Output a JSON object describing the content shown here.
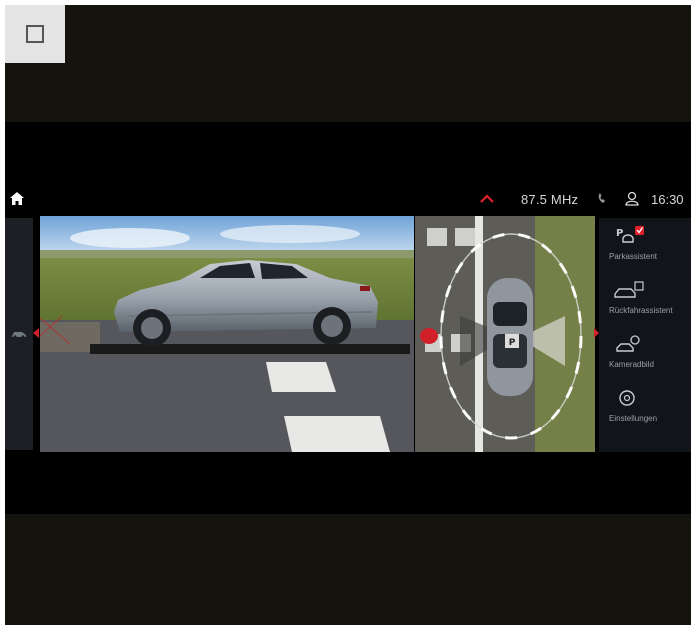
{
  "statusbar": {
    "radio": "87.5 MHz",
    "time": "16:30",
    "icons": [
      "home-icon",
      "chevron-up-icon",
      "phone-icon",
      "user-icon"
    ]
  },
  "menu": {
    "items": [
      {
        "label": "Parkassistent",
        "icon": "park-assist-icon",
        "active": true
      },
      {
        "label": "Rückfahrassistent",
        "icon": "reverse-assist-icon",
        "active": false
      },
      {
        "label": "Kameradbild",
        "icon": "camera-view-icon",
        "active": false
      },
      {
        "label": "Einstellungen",
        "icon": "settings-icon",
        "active": false
      }
    ]
  },
  "colors": {
    "accent_red": "#e0202a",
    "panel_bg": "#111419",
    "status_text": "#d8d8d8"
  }
}
